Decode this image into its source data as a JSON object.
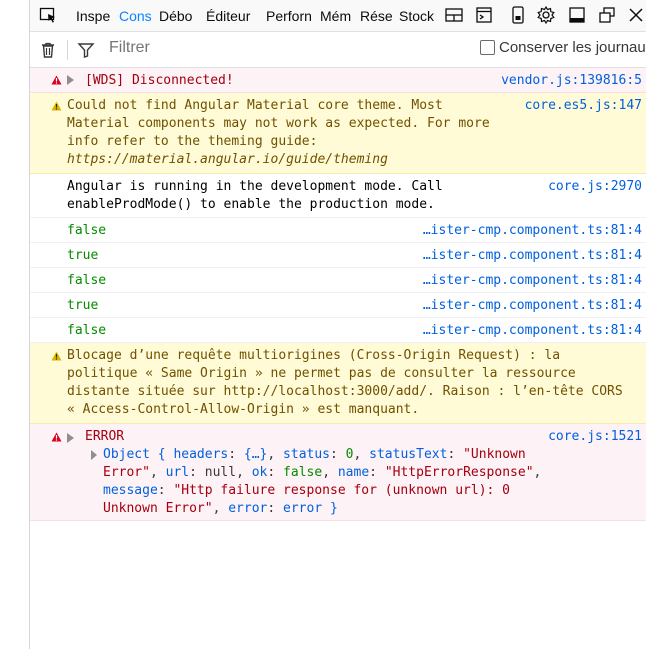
{
  "tabs": [
    {
      "label": "Inspe",
      "active": false
    },
    {
      "label": "Cons",
      "active": true
    },
    {
      "label": "Débo",
      "active": false
    },
    {
      "label": "Éditeur",
      "active": false
    },
    {
      "label": "Perforn",
      "active": false
    },
    {
      "label": "Mém",
      "active": false
    },
    {
      "label": "Rése",
      "active": false
    },
    {
      "label": "Stock",
      "active": false
    }
  ],
  "filter": {
    "placeholder": "Filtrer",
    "persist_label": "Conserver les journaux",
    "persist_checked": false
  },
  "messages": [
    {
      "type": "error",
      "text": "[WDS] Disconnected!",
      "source": "vendor.js:139816:5"
    },
    {
      "type": "warning",
      "line1": "Could not find Angular Material core theme. Most",
      "line2": "Material components may not work as expected. For more",
      "line3": "info refer to the theming guide:",
      "link": "https://material.angular.io/guide/theming",
      "source": "core.es5.js:147"
    },
    {
      "type": "log",
      "line1": "Angular is running in the development mode. Call",
      "line2": "enableProdMode() to enable the production mode.",
      "source": "core.js:2970"
    },
    {
      "type": "log",
      "text": "false",
      "source": "…ister-cmp.component.ts:81:4"
    },
    {
      "type": "log",
      "text": "true",
      "source": "…ister-cmp.component.ts:81:4"
    },
    {
      "type": "log",
      "text": "false",
      "source": "…ister-cmp.component.ts:81:4"
    },
    {
      "type": "log",
      "text": "true",
      "source": "…ister-cmp.component.ts:81:4"
    },
    {
      "type": "log",
      "text": "false",
      "source": "…ister-cmp.component.ts:81:4"
    },
    {
      "type": "warning",
      "line1": "Blocage d’une requête multiorigines (Cross-Origin Request) : la",
      "line2": "politique « Same Origin » ne permet pas de consulter la ressource",
      "line3": "distante située sur http://localhost:3000/add/. Raison : l’en-tête CORS",
      "line4": "« Access-Control-Allow-Origin » est manquant."
    },
    {
      "type": "error",
      "text": "ERROR",
      "source": "core.js:1521",
      "object": {
        "prefix": "Object {",
        "headers_key": "headers",
        "headers_val": "{…}",
        "status_key": "status",
        "status_val": "0",
        "statusText_key": "statusText",
        "statusText_val": "\"Unknown",
        "statusText_val2": "Error\"",
        "url_key": "url",
        "url_val": "null",
        "ok_key": "ok",
        "ok_val": "false",
        "name_key": "name",
        "name_val": "\"HttpErrorResponse\"",
        "message_key": "message",
        "message_val": "\"Http failure response for (unknown url): 0",
        "message_val2": "Unknown Error\"",
        "error_key": "error",
        "error_val": "error",
        "suffix": "}"
      }
    }
  ],
  "colors": {
    "error_bg": "#fdf2f5",
    "warning_bg": "#fffbd6",
    "accent": "#0a84ff",
    "link": "#0060df",
    "bool": "#058b00"
  }
}
